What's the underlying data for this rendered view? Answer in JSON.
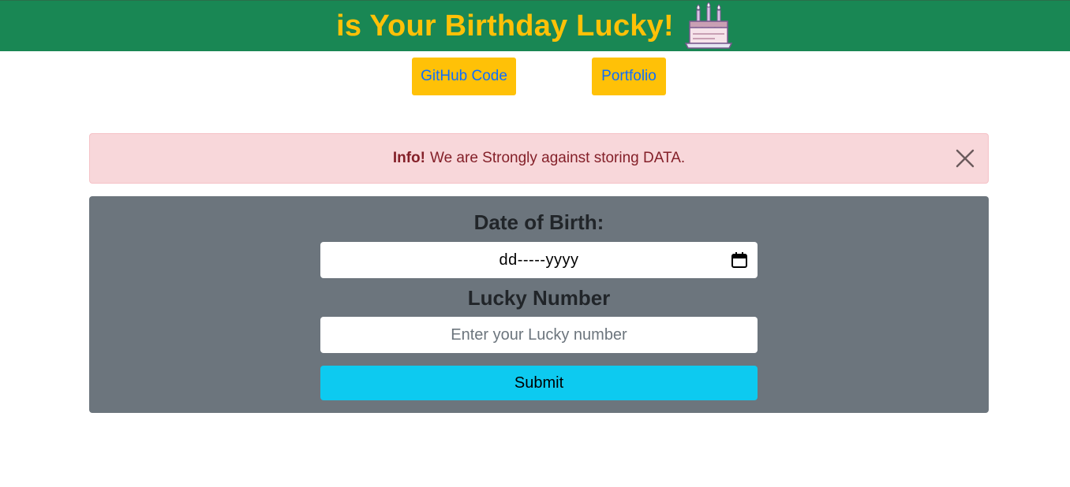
{
  "header": {
    "title": "is Your Birthday Lucky!",
    "icon": "cake-icon",
    "background": "#198754",
    "title_color": "#ffc107"
  },
  "links": {
    "github_label": "GitHub Code",
    "portfolio_label": "Portfolio",
    "button_color": "#ffc107",
    "text_color": "#0d6efd"
  },
  "alert": {
    "strong": "Info!",
    "message": "We are Strongly against storing DATA.",
    "close_icon": "close-icon",
    "background": "#f8d7da",
    "text_color": "#842029"
  },
  "form": {
    "dob_label": "Date of Birth:",
    "dob_value": "dd-----yyyy",
    "calendar_icon": "calendar-icon",
    "lucky_label": "Lucky Number",
    "lucky_placeholder": "Enter your Lucky number",
    "lucky_value": "",
    "submit_label": "Submit",
    "panel_color": "#6c757d",
    "submit_color": "#0dcaf0"
  }
}
